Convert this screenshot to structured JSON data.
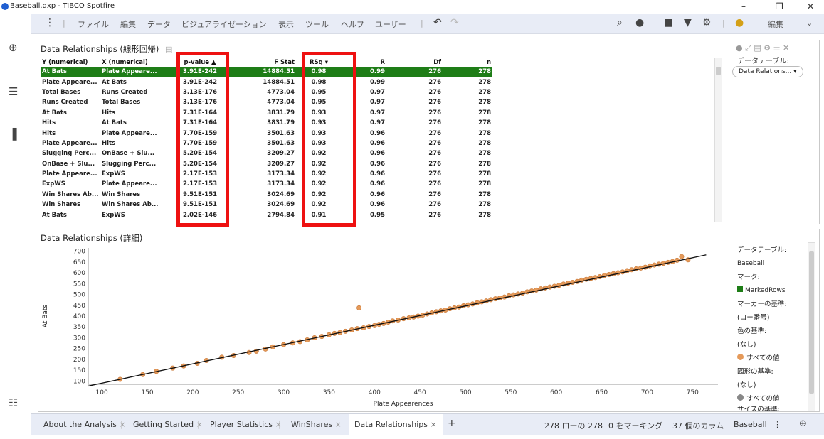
{
  "window": {
    "title": "Baseball.dxp - TIBCO Spotfire",
    "minimize": "–",
    "restore": "❐",
    "close": "✕"
  },
  "menu": {
    "items": [
      "ファイル",
      "編集",
      "データ",
      "ビジュアライゼーション",
      "表示",
      "ツール",
      "ヘルプ",
      "ユーザー"
    ],
    "edit_mode": "編集"
  },
  "table_panel": {
    "title": "Data Relationships (線形回帰)",
    "columns": [
      "Y (numerical)",
      "X (numerical)",
      "p-value ▲",
      "F Stat",
      "RSq ▾",
      "R",
      "Df",
      "n"
    ],
    "rows": [
      [
        "At Bats",
        "Plate Appeare...",
        "3.91E-242",
        "14884.51",
        "0.98",
        "0.99",
        "276",
        "278"
      ],
      [
        "Plate Appeare...",
        "At Bats",
        "3.91E-242",
        "14884.51",
        "0.98",
        "0.99",
        "276",
        "278"
      ],
      [
        "Total Bases",
        "Runs Created",
        "3.13E-176",
        "4773.04",
        "0.95",
        "0.97",
        "276",
        "278"
      ],
      [
        "Runs Created",
        "Total Bases",
        "3.13E-176",
        "4773.04",
        "0.95",
        "0.97",
        "276",
        "278"
      ],
      [
        "At Bats",
        "Hits",
        "7.31E-164",
        "3831.79",
        "0.93",
        "0.97",
        "276",
        "278"
      ],
      [
        "Hits",
        "At Bats",
        "7.31E-164",
        "3831.79",
        "0.93",
        "0.97",
        "276",
        "278"
      ],
      [
        "Hits",
        "Plate Appeare...",
        "7.70E-159",
        "3501.63",
        "0.93",
        "0.96",
        "276",
        "278"
      ],
      [
        "Plate Appeare...",
        "Hits",
        "7.70E-159",
        "3501.63",
        "0.93",
        "0.96",
        "276",
        "278"
      ],
      [
        "Slugging Perc...",
        "OnBase + Slu...",
        "5.20E-154",
        "3209.27",
        "0.92",
        "0.96",
        "276",
        "278"
      ],
      [
        "OnBase + Slu...",
        "Slugging Perc...",
        "5.20E-154",
        "3209.27",
        "0.92",
        "0.96",
        "276",
        "278"
      ],
      [
        "Plate Appeare...",
        "ExpWS",
        "2.17E-153",
        "3173.34",
        "0.92",
        "0.96",
        "276",
        "278"
      ],
      [
        "ExpWS",
        "Plate Appeare...",
        "2.17E-153",
        "3173.34",
        "0.92",
        "0.96",
        "276",
        "278"
      ],
      [
        "Win Shares Ab...",
        "Win Shares",
        "9.51E-151",
        "3024.69",
        "0.92",
        "0.96",
        "276",
        "278"
      ],
      [
        "Win Shares",
        "Win Shares Ab...",
        "9.51E-151",
        "3024.69",
        "0.92",
        "0.96",
        "276",
        "278"
      ],
      [
        "At Bats",
        "ExpWS",
        "2.02E-146",
        "2794.84",
        "0.91",
        "0.95",
        "276",
        "278"
      ]
    ],
    "side": {
      "label": "データテーブル:",
      "dropdown": "Data Relations... ▾"
    },
    "colors": {
      "marked": "#1e7d17",
      "highlight_box": "#ee1111"
    }
  },
  "plot_panel": {
    "title": "Data Relationships (詳細)",
    "legend": {
      "datatable_label": "データテーブル:",
      "datatable_value": "Baseball",
      "mark_label": "マーク:",
      "mark_value": "MarkedRows",
      "marker_by_label": "マーカーの基準:",
      "marker_by_value": "(ロー番号)",
      "color_by_label": "色の基準:",
      "color_by_value": "(なし)",
      "color_all": "すべての値",
      "shape_by_label": "図形の基準:",
      "shape_by_value": "(なし)",
      "shape_all": "すべての値",
      "size_by_label": "サイズの基準:"
    }
  },
  "chart_data": {
    "type": "scatter",
    "title": "",
    "xlabel": "Plate Appearences",
    "ylabel": "At Bats",
    "xlim": [
      85,
      778
    ],
    "ylim": [
      85,
      715
    ],
    "xticks": [
      100,
      150,
      200,
      250,
      300,
      350,
      400,
      450,
      500,
      550,
      600,
      650,
      700,
      750
    ],
    "yticks": [
      100,
      150,
      200,
      250,
      300,
      350,
      400,
      450,
      500,
      550,
      600,
      650,
      700
    ],
    "point_color": "#e59a5a",
    "marked_color": "#1e7d17",
    "line_color": "#111111",
    "regression_line": {
      "x": [
        85,
        765
      ],
      "y": [
        77,
        683
      ]
    },
    "series": [
      {
        "x": [
          120,
          145,
          160,
          178,
          190,
          205,
          215,
          232,
          245,
          262,
          270,
          280,
          288,
          300,
          310,
          318,
          326,
          334,
          342,
          350,
          356,
          362,
          368,
          375,
          381,
          383,
          388,
          394,
          400,
          405,
          410,
          415,
          420,
          426,
          432,
          438,
          443,
          448,
          453,
          458,
          463,
          468,
          473,
          478,
          483,
          488,
          493,
          498,
          503,
          508,
          513,
          518,
          523,
          528,
          533,
          538,
          543,
          548,
          553,
          558,
          563,
          568,
          573,
          578,
          583,
          588,
          593,
          598,
          603,
          608,
          613,
          618,
          623,
          628,
          633,
          638,
          643,
          648,
          653,
          658,
          663,
          668,
          673,
          678,
          683,
          688,
          693,
          698,
          703,
          708,
          713,
          718,
          723,
          728,
          733,
          738,
          745
        ],
        "y": [
          108,
          130,
          145,
          160,
          170,
          182,
          195,
          210,
          218,
          232,
          238,
          248,
          258,
          268,
          276,
          282,
          290,
          300,
          306,
          314,
          320,
          324,
          330,
          336,
          342,
          438,
          346,
          352,
          356,
          362,
          366,
          372,
          378,
          382,
          388,
          392,
          396,
          400,
          405,
          410,
          415,
          420,
          424,
          428,
          434,
          438,
          442,
          448,
          452,
          456,
          462,
          466,
          470,
          476,
          480,
          484,
          488,
          494,
          498,
          502,
          506,
          512,
          516,
          520,
          526,
          530,
          534,
          538,
          542,
          548,
          552,
          556,
          560,
          566,
          570,
          574,
          578,
          582,
          588,
          592,
          596,
          600,
          604,
          610,
          614,
          618,
          622,
          626,
          632,
          636,
          640,
          644,
          648,
          652,
          658,
          675,
          660
        ]
      }
    ]
  },
  "bottom": {
    "tabs": [
      "About the Analysis",
      "Getting Started",
      "Player Statistics",
      "WinShares",
      "Data Relationships"
    ],
    "status_rows": "278 ローの 278",
    "status_marked": "0 をマーキング",
    "status_columns": "37 個のカラム",
    "status_table": "Baseball"
  }
}
